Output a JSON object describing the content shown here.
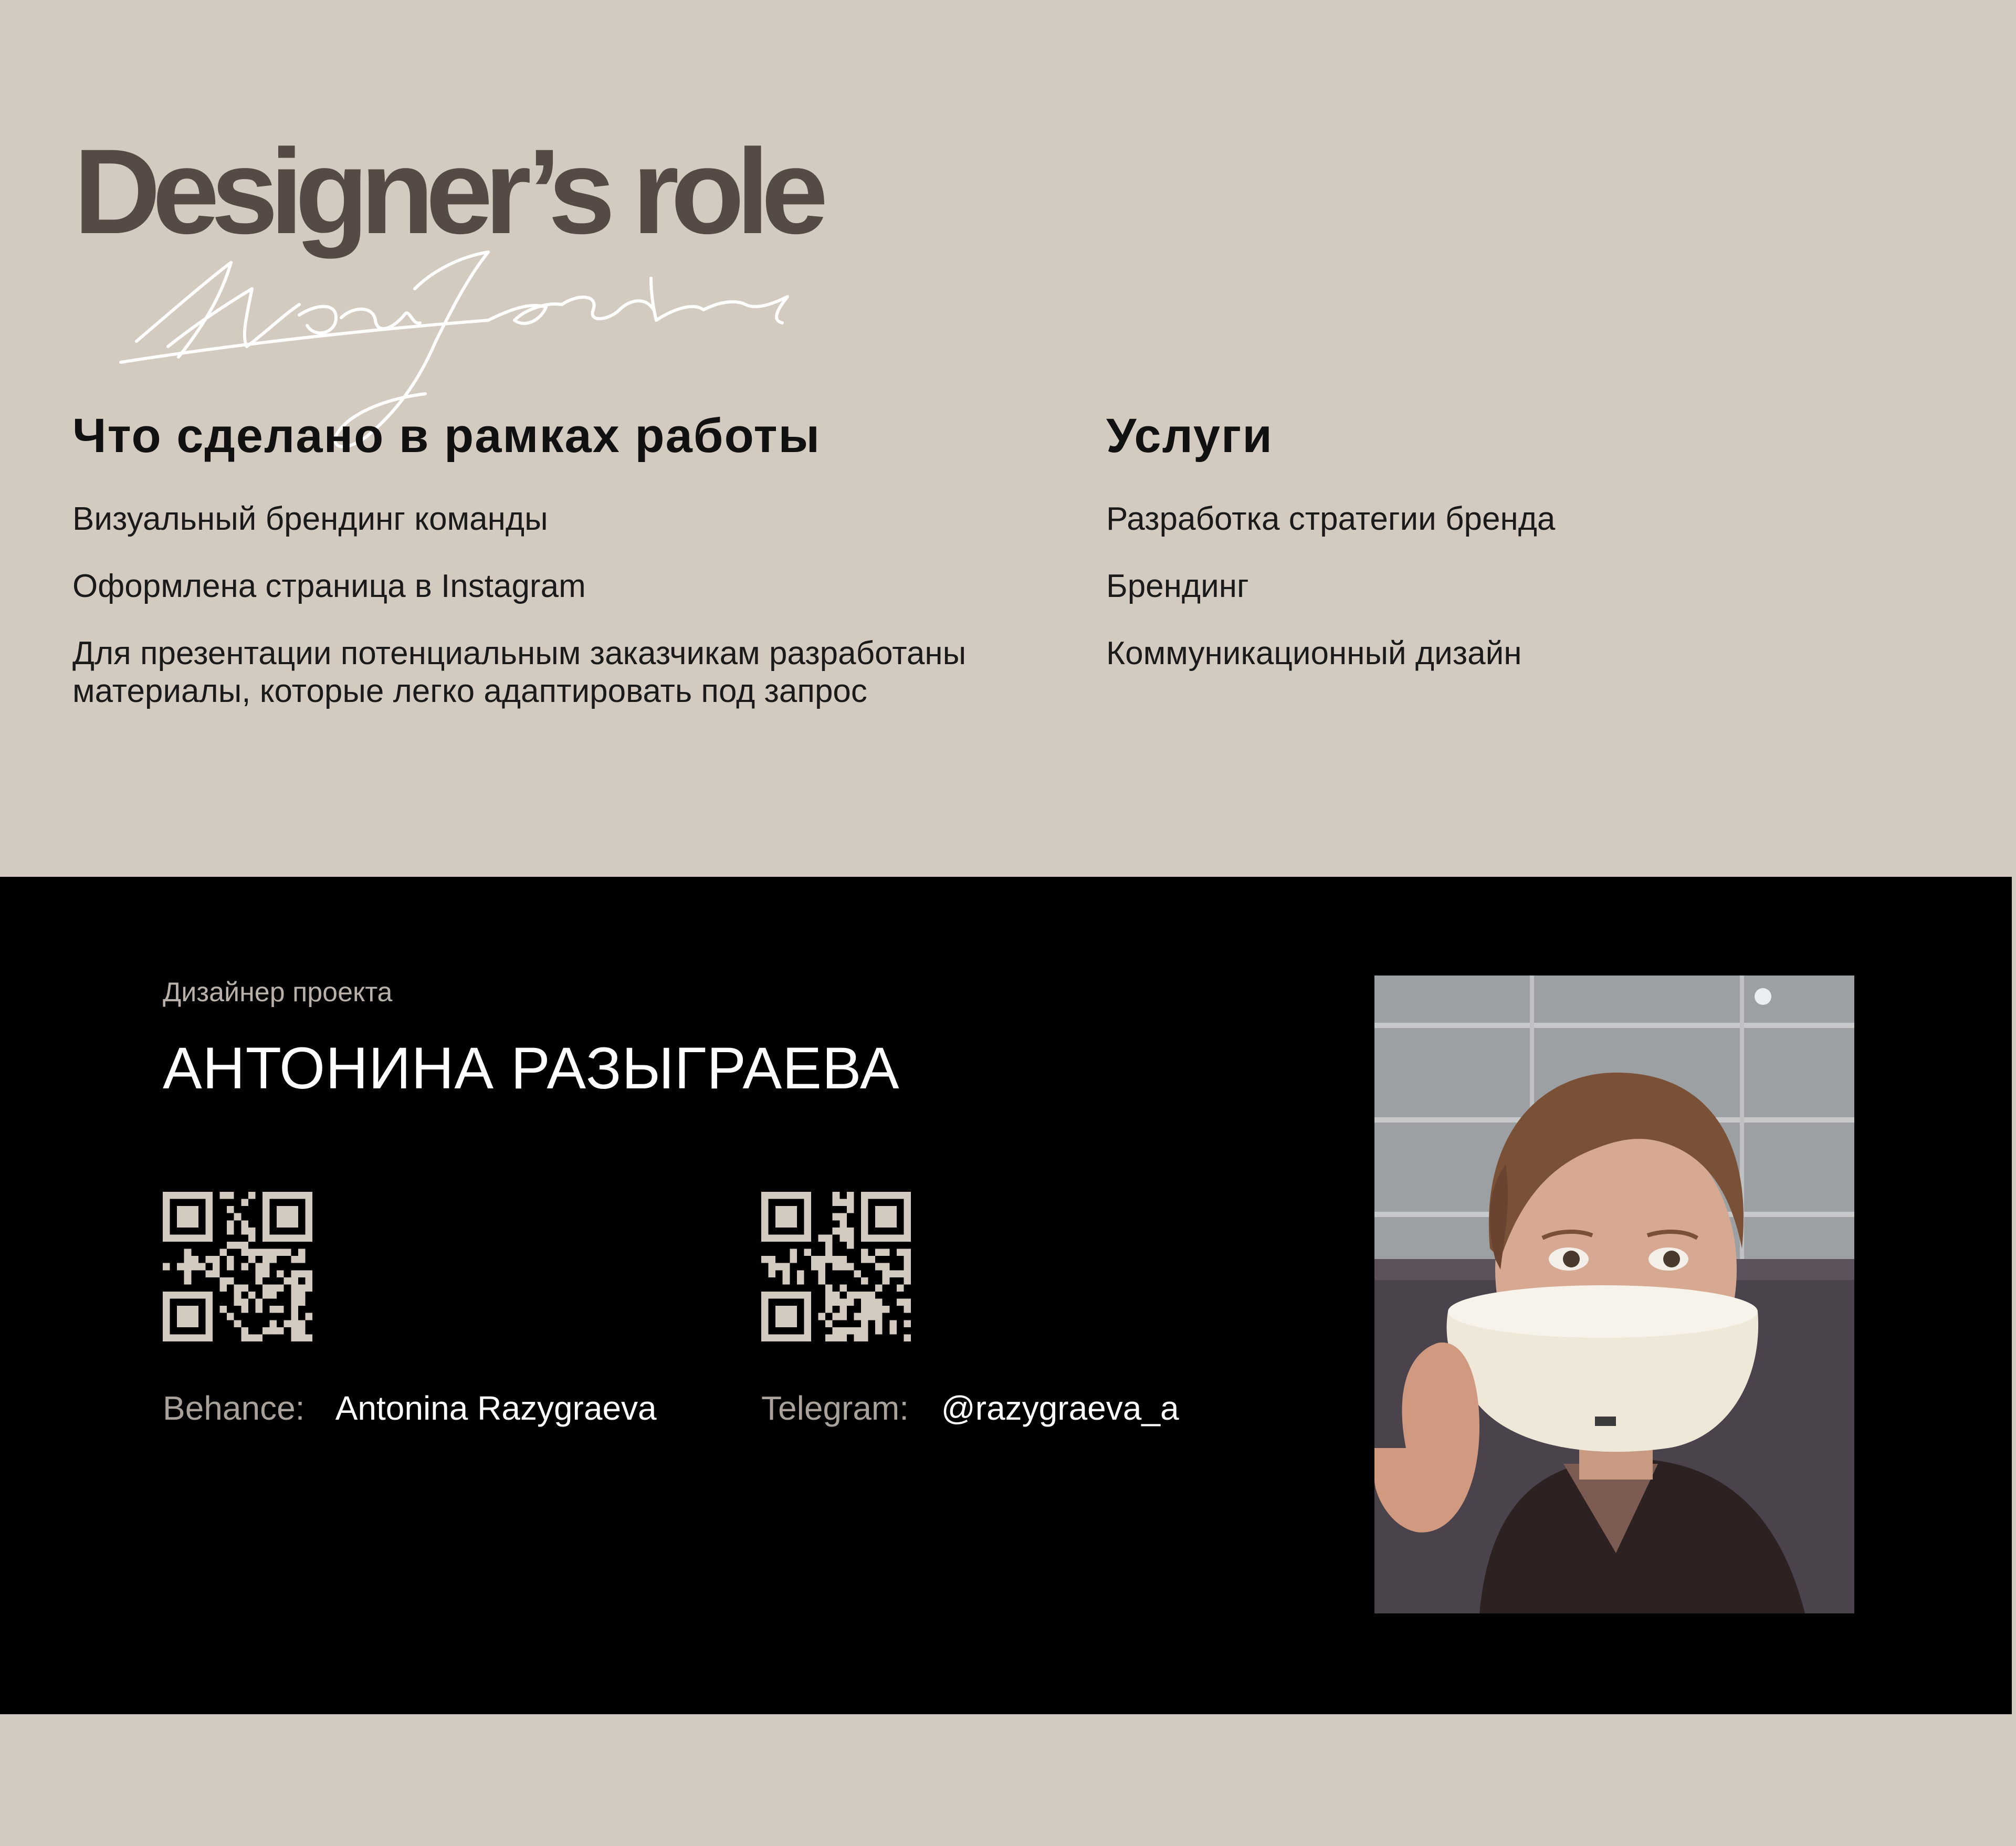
{
  "header": {
    "title": "Designer’s role",
    "script_overlay": "Итоги работы"
  },
  "work": {
    "heading": "Что сделано в рамках работы",
    "items": [
      "Визуальный брендинг команды",
      "Оформлена страница в Instagram",
      "Для презентации потенциальным заказчикам разработаны\nматериалы, которые легко адаптировать под запрос"
    ]
  },
  "services": {
    "heading": "Услуги",
    "items": [
      "Разработка стратегии бренда",
      "Брендинг",
      "Коммуникационный дизайн"
    ]
  },
  "designer": {
    "role_label": "Дизайнер проекта",
    "name": "АНТОНИНА РАЗЫГРАЕВА",
    "behance": {
      "label": "Behance:",
      "value": "Antonina Razygraeva",
      "qr_icon": "qr-code-icon"
    },
    "telegram": {
      "label": "Telegram:",
      "value": "@razygraeva_a",
      "qr_icon": "qr-code-icon"
    }
  },
  "colors": {
    "background": "#d3cbc0",
    "title": "#564a44",
    "footer": "#000000",
    "qr": "#d3cbc0"
  }
}
